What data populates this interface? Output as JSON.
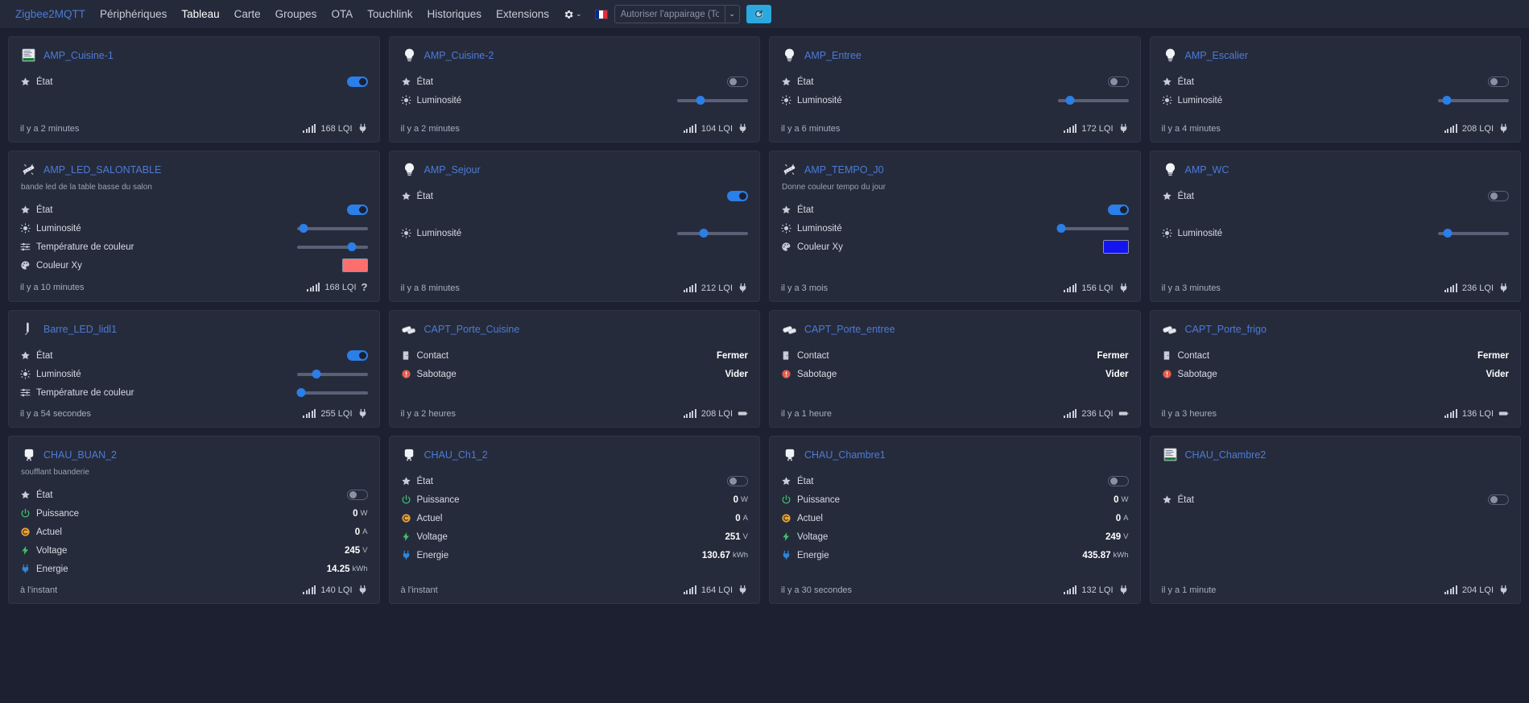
{
  "nav": {
    "brand": "Zigbee2MQTT",
    "links": [
      {
        "label": "Périphériques",
        "active": false
      },
      {
        "label": "Tableau",
        "active": true
      },
      {
        "label": "Carte",
        "active": false
      },
      {
        "label": "Groupes",
        "active": false
      },
      {
        "label": "OTA",
        "active": false
      },
      {
        "label": "Touchlink",
        "active": false
      },
      {
        "label": "Historiques",
        "active": false
      },
      {
        "label": "Extensions",
        "active": false
      }
    ],
    "settings_icon": "gear-icon",
    "settings_caret": "⌄",
    "language_flag": "france-flag-icon",
    "pair_placeholder": "Autoriser l'appairage (Tout)",
    "pair_value": "",
    "pair_caret": "⌄",
    "refresh_icon": "refresh-icon"
  },
  "labels": {
    "state": "État",
    "brightness": "Luminosité",
    "color_temp": "Température de couleur",
    "color_xy": "Couleur Xy",
    "contact": "Contact",
    "tamper": "Sabotage",
    "power": "Puissance",
    "current": "Actuel",
    "voltage": "Voltage",
    "energy": "Energie",
    "lqi_suffix": "LQI"
  },
  "cards": [
    {
      "name": "AMP_Cuisine-1",
      "icon": "relay-module-icon",
      "desc": "",
      "rows": [
        {
          "type": "toggle",
          "label": "État",
          "icon": "star-icon",
          "on": true
        }
      ],
      "time": "il y a 2 minutes",
      "lqi": "168",
      "power_icon": "plug-icon"
    },
    {
      "name": "AMP_Cuisine-2",
      "icon": "bulb-icon",
      "desc": "",
      "rows": [
        {
          "type": "toggle",
          "label": "État",
          "icon": "star-icon",
          "on": false
        },
        {
          "type": "slider",
          "label": "Luminosité",
          "icon": "sun-icon",
          "percent": 33
        }
      ],
      "time": "il y a 2 minutes",
      "lqi": "104",
      "power_icon": "plug-icon"
    },
    {
      "name": "AMP_Entree",
      "icon": "bulb-icon",
      "desc": "",
      "rows": [
        {
          "type": "toggle",
          "label": "État",
          "icon": "star-icon",
          "on": false
        },
        {
          "type": "slider",
          "label": "Luminosité",
          "icon": "sun-icon",
          "percent": 18
        }
      ],
      "time": "il y a 6 minutes",
      "lqi": "172",
      "power_icon": "plug-icon"
    },
    {
      "name": "AMP_Escalier",
      "icon": "bulb-icon",
      "desc": "",
      "rows": [
        {
          "type": "toggle",
          "label": "État",
          "icon": "star-icon",
          "on": false
        },
        {
          "type": "slider",
          "label": "Luminosité",
          "icon": "sun-icon",
          "percent": 12
        }
      ],
      "time": "il y a 4 minutes",
      "lqi": "208",
      "power_icon": "plug-icon"
    },
    {
      "name": "AMP_LED_SALONTABLE",
      "icon": "led-strip-icon",
      "desc": "bande led de la table basse du salon",
      "tall": true,
      "rows": [
        {
          "type": "toggle",
          "label": "État",
          "icon": "star-icon",
          "on": true
        },
        {
          "type": "slider",
          "label": "Luminosité",
          "icon": "sun-icon",
          "percent": 10
        },
        {
          "type": "slider",
          "label": "Température de couleur",
          "icon": "sliders-icon",
          "percent": 78
        },
        {
          "type": "color",
          "label": "Couleur Xy",
          "icon": "palette-icon",
          "color": "#fb6f6f"
        }
      ],
      "time": "il y a 10 minutes",
      "lqi": "168",
      "power_icon": "question-icon"
    },
    {
      "name": "AMP_Sejour",
      "icon": "bulb-icon",
      "desc": "",
      "tall": true,
      "rows": [
        {
          "type": "toggle",
          "label": "État",
          "icon": "star-icon",
          "on": true
        },
        {
          "type": "spacer"
        },
        {
          "type": "slider",
          "label": "Luminosité",
          "icon": "sun-icon",
          "percent": 38
        }
      ],
      "time": "il y a 8 minutes",
      "lqi": "212",
      "power_icon": "plug-icon"
    },
    {
      "name": "AMP_TEMPO_J0",
      "icon": "led-strip-icon",
      "desc": "Donne couleur tempo du jour",
      "tall": true,
      "rows": [
        {
          "type": "toggle",
          "label": "État",
          "icon": "star-icon",
          "on": true
        },
        {
          "type": "slider",
          "label": "Luminosité",
          "icon": "sun-icon",
          "percent": 5
        },
        {
          "type": "color",
          "label": "Couleur Xy",
          "icon": "palette-icon",
          "color": "#1414f0"
        }
      ],
      "time": "il y a 3 mois",
      "lqi": "156",
      "power_icon": "plug-icon"
    },
    {
      "name": "AMP_WC",
      "icon": "bulb-icon",
      "desc": "",
      "tall": true,
      "rows": [
        {
          "type": "toggle",
          "label": "État",
          "icon": "star-icon",
          "on": false
        },
        {
          "type": "spacer"
        },
        {
          "type": "slider",
          "label": "Luminosité",
          "icon": "sun-icon",
          "percent": 14
        }
      ],
      "time": "il y a 3 minutes",
      "lqi": "236",
      "power_icon": "plug-icon"
    },
    {
      "name": "Barre_LED_lidl1",
      "icon": "led-bar-icon",
      "desc": "",
      "rows": [
        {
          "type": "toggle",
          "label": "État",
          "icon": "star-icon",
          "on": true
        },
        {
          "type": "slider",
          "label": "Luminosité",
          "icon": "sun-icon",
          "percent": 28
        },
        {
          "type": "slider",
          "label": "Température de couleur",
          "icon": "sliders-icon",
          "percent": 6
        }
      ],
      "time": "il y a 54 secondes",
      "lqi": "255",
      "power_icon": "plug-icon"
    },
    {
      "name": "CAPT_Porte_Cuisine",
      "icon": "contact-sensor-icon",
      "desc": "",
      "rows": [
        {
          "type": "text",
          "label": "Contact",
          "icon": "door-icon",
          "value": "Fermer"
        },
        {
          "type": "text",
          "label": "Sabotage",
          "icon": "alert-icon",
          "value": "Vider"
        }
      ],
      "time": "il y a 2 heures",
      "lqi": "208",
      "power_icon": "battery-icon"
    },
    {
      "name": "CAPT_Porte_entree",
      "icon": "contact-sensor-icon",
      "desc": "",
      "rows": [
        {
          "type": "text",
          "label": "Contact",
          "icon": "door-icon",
          "value": "Fermer"
        },
        {
          "type": "text",
          "label": "Sabotage",
          "icon": "alert-icon",
          "value": "Vider"
        }
      ],
      "time": "il y a 1 heure",
      "lqi": "236",
      "power_icon": "battery-icon"
    },
    {
      "name": "CAPT_Porte_frigo",
      "icon": "contact-sensor-icon",
      "desc": "",
      "rows": [
        {
          "type": "text",
          "label": "Contact",
          "icon": "door-icon",
          "value": "Fermer"
        },
        {
          "type": "text",
          "label": "Sabotage",
          "icon": "alert-icon",
          "value": "Vider"
        }
      ],
      "time": "il y a 3 heures",
      "lqi": "136",
      "power_icon": "battery-icon"
    },
    {
      "name": "CHAU_BUAN_2",
      "icon": "smart-plug-icon",
      "desc": "soufflant buanderie",
      "tall": true,
      "rows": [
        {
          "type": "toggle",
          "label": "État",
          "icon": "star-icon",
          "on": false
        },
        {
          "type": "meter",
          "label": "Puissance",
          "icon": "power-icon",
          "value": "0",
          "unit": "W"
        },
        {
          "type": "meter",
          "label": "Actuel",
          "icon": "current-icon",
          "value": "0",
          "unit": "A"
        },
        {
          "type": "meter",
          "label": "Voltage",
          "icon": "bolt-icon",
          "value": "245",
          "unit": "V"
        },
        {
          "type": "meter",
          "label": "Energie",
          "icon": "energy-plug-icon",
          "value": "14.25",
          "unit": "kWh"
        }
      ],
      "time": "à l'instant",
      "lqi": "140",
      "power_icon": "plug-icon"
    },
    {
      "name": "CHAU_Ch1_2",
      "icon": "smart-plug-icon",
      "desc": "",
      "tall": true,
      "rows": [
        {
          "type": "toggle",
          "label": "État",
          "icon": "star-icon",
          "on": false
        },
        {
          "type": "meter",
          "label": "Puissance",
          "icon": "power-icon",
          "value": "0",
          "unit": "W"
        },
        {
          "type": "meter",
          "label": "Actuel",
          "icon": "current-icon",
          "value": "0",
          "unit": "A"
        },
        {
          "type": "meter",
          "label": "Voltage",
          "icon": "bolt-icon",
          "value": "251",
          "unit": "V"
        },
        {
          "type": "meter",
          "label": "Energie",
          "icon": "energy-plug-icon",
          "value": "130.67",
          "unit": "kWh"
        }
      ],
      "time": "à l'instant",
      "lqi": "164",
      "power_icon": "plug-icon"
    },
    {
      "name": "CHAU_Chambre1",
      "icon": "smart-plug-icon",
      "desc": "",
      "tall": true,
      "rows": [
        {
          "type": "toggle",
          "label": "État",
          "icon": "star-icon",
          "on": false
        },
        {
          "type": "meter",
          "label": "Puissance",
          "icon": "power-icon",
          "value": "0",
          "unit": "W"
        },
        {
          "type": "meter",
          "label": "Actuel",
          "icon": "current-icon",
          "value": "0",
          "unit": "A"
        },
        {
          "type": "meter",
          "label": "Voltage",
          "icon": "bolt-icon",
          "value": "249",
          "unit": "V"
        },
        {
          "type": "meter",
          "label": "Energie",
          "icon": "energy-plug-icon",
          "value": "435.87",
          "unit": "kWh"
        }
      ],
      "time": "il y a 30 secondes",
      "lqi": "132",
      "power_icon": "plug-icon"
    },
    {
      "name": "CHAU_Chambre2",
      "icon": "relay-module-icon",
      "desc": "",
      "tall": true,
      "rows": [
        {
          "type": "spacer"
        },
        {
          "type": "toggle",
          "label": "État",
          "icon": "star-icon",
          "on": false
        }
      ],
      "time": "il y a 1 minute",
      "lqi": "204",
      "power_icon": "plug-icon"
    }
  ]
}
